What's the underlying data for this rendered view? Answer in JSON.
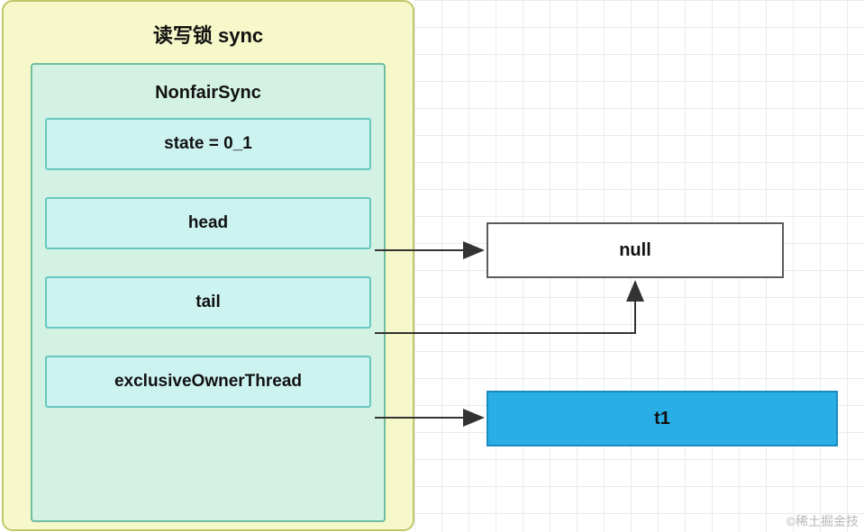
{
  "sync": {
    "title": "读写锁 sync",
    "nonfair": {
      "title": "NonfairSync",
      "state": "state = 0_1",
      "head": "head",
      "tail": "tail",
      "exclusiveOwnerThread": "exclusiveOwnerThread"
    }
  },
  "nodes": {
    "nullNode": "null",
    "t1": "t1"
  },
  "watermark": "©稀土掘金技"
}
